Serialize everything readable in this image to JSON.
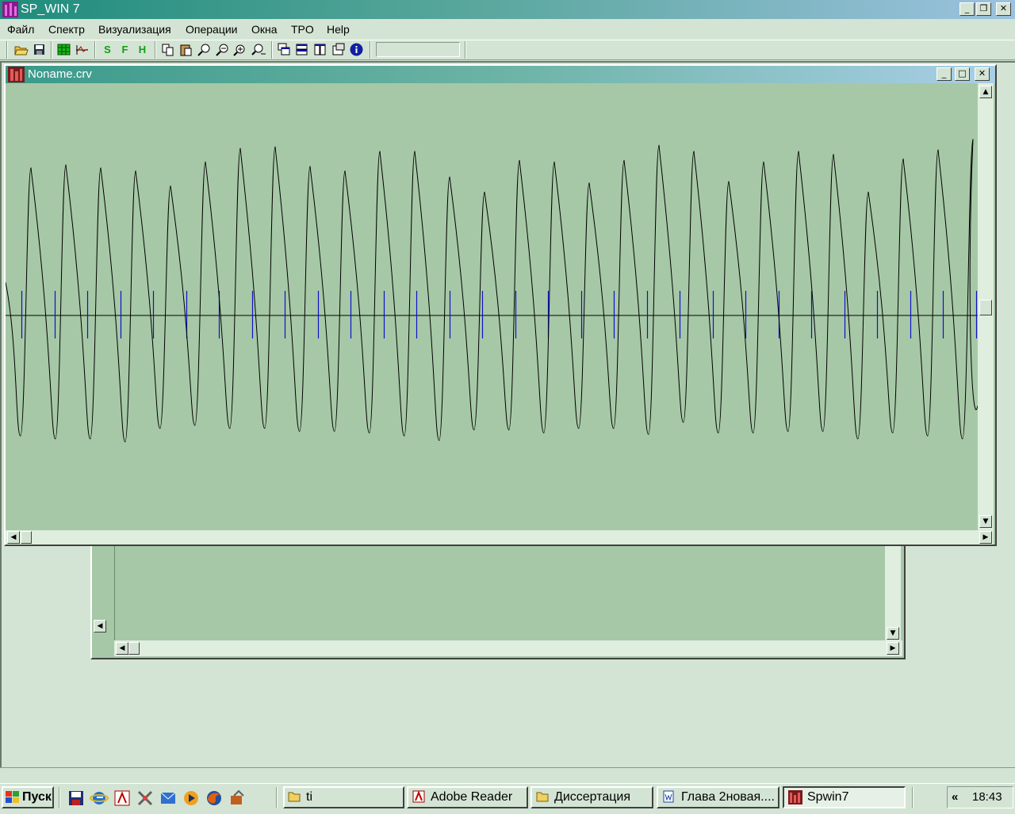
{
  "window": {
    "title": "SP_WIN 7",
    "controls": {
      "minimize": "_",
      "restore": "❐",
      "close": "✕"
    }
  },
  "menu": [
    "Файл",
    "Спектр",
    "Визуализация",
    "Операции",
    "Окна",
    "TPO",
    "Help"
  ],
  "toolbar": {
    "buttons": [
      "open-folder-icon",
      "save-icon",
      "grid-icon",
      "curve-icon",
      "S",
      "F",
      "H",
      "copy-icon",
      "paste-icon",
      "zoom-fit-icon",
      "zoom-out-icon",
      "zoom-in-icon",
      "zoom-reset-icon",
      "cascade-icon",
      "tile-horizontal-icon",
      "tile-vertical-icon",
      "properties-icon",
      "info-icon"
    ],
    "input_value": ""
  },
  "document": {
    "title": "Noname.crv",
    "controls": {
      "minimize": "_",
      "restore": "□",
      "close": "✕"
    }
  },
  "chart_data": {
    "type": "line",
    "xlabel": "",
    "ylabel": "",
    "grid": false,
    "baseline": 0,
    "ylim": [
      -1.1,
      1.55
    ],
    "marker_color": "#1010c8",
    "line_color": "#000000",
    "peaks": [
      0.98,
      1.0,
      0.98,
      0.96,
      0.86,
      1.02,
      1.11,
      1.12,
      0.99,
      0.96,
      1.09,
      1.09,
      0.92,
      0.82,
      1.03,
      1.02,
      0.88,
      1.03,
      1.13,
      1.09,
      0.89,
      1.02,
      1.09,
      1.07,
      0.82,
      1.04,
      1.1,
      1.17
    ],
    "troughs": [
      -0.8,
      -0.82,
      -0.82,
      -0.84,
      -0.75,
      -0.73,
      -0.75,
      -0.75,
      -0.77,
      -0.77,
      -0.78,
      -0.8,
      -0.83,
      -0.76,
      -0.76,
      -0.78,
      -0.75,
      -0.75,
      -0.79,
      -0.71,
      -0.78,
      -0.78,
      -0.77,
      -0.77,
      -0.82,
      -0.78,
      -0.8,
      -0.82
    ],
    "markers": 30
  },
  "taskbar": {
    "start_label": "Пуск",
    "quick_launch": [
      "floppy-icon",
      "ie-icon",
      "acrobat-icon",
      "tools-icon",
      "outlook-icon",
      "media-player-icon",
      "firefox-icon",
      "app-icon"
    ],
    "tasks": [
      {
        "label": "ti",
        "icon": "folder-icon",
        "active": false
      },
      {
        "label": "Adobe Reader",
        "icon": "acrobat-icon",
        "active": false
      },
      {
        "label": "Диссертация",
        "icon": "folder-icon",
        "active": false
      },
      {
        "label": "Глава 2новая....",
        "icon": "word-icon",
        "active": false
      },
      {
        "label": "Spwin7",
        "icon": "spwin-icon",
        "active": true
      }
    ],
    "tray_expand": "«",
    "clock": "18:43"
  }
}
